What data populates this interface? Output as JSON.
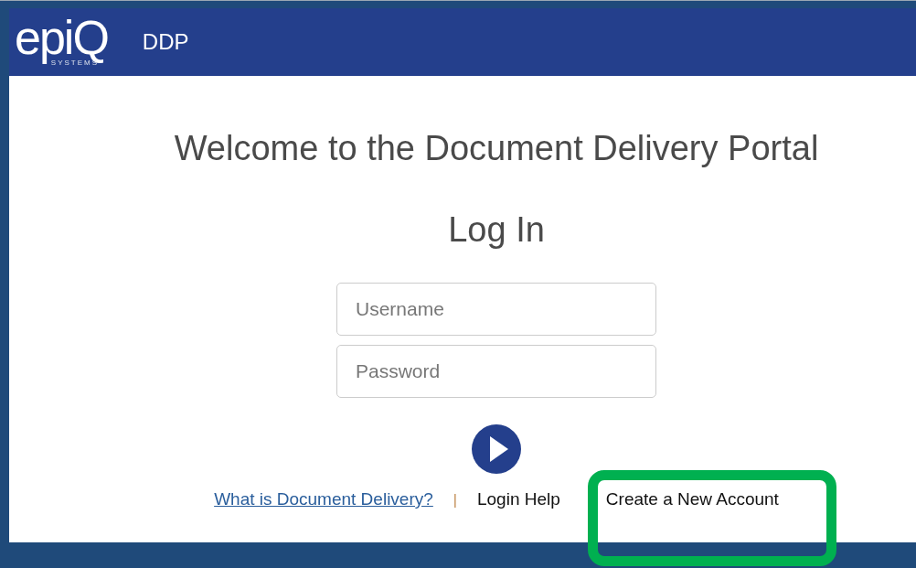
{
  "header": {
    "logo": {
      "wordmark": "epiQ",
      "tagline": "SYSTEMS"
    },
    "app_name": "DDP"
  },
  "welcome": "Welcome to the Document Delivery Portal",
  "heading": "Log In",
  "fields": [
    {
      "placeholder": "Username"
    },
    {
      "placeholder": "Password"
    }
  ],
  "links": [
    {
      "label": "What is Document Delivery?",
      "kind": "link"
    },
    {
      "label": "|",
      "kind": "separator"
    },
    {
      "label": "Login Help",
      "kind": "plain"
    },
    {
      "label": "Create a New Account",
      "kind": "highlighted"
    }
  ]
}
